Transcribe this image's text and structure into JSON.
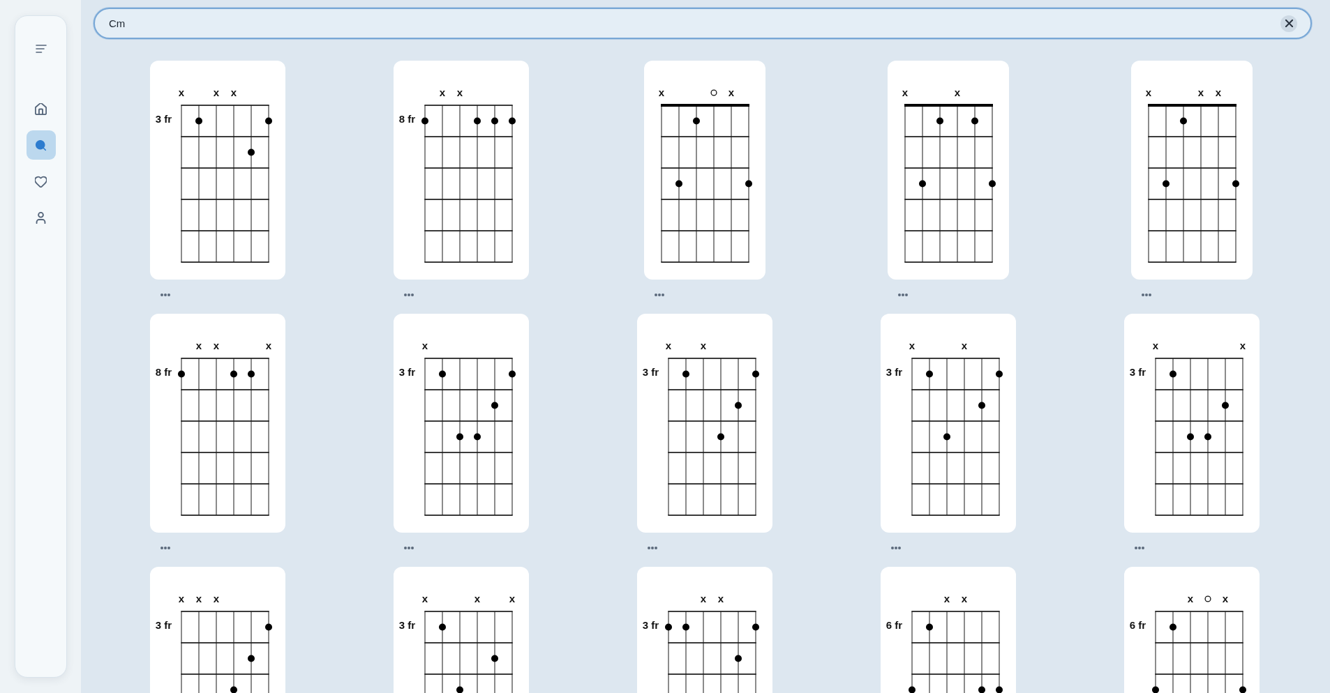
{
  "sidebar": {
    "nav": [
      {
        "kind": "home",
        "selected": false
      },
      {
        "kind": "search",
        "selected": true
      },
      {
        "kind": "favorites",
        "selected": false
      },
      {
        "kind": "profile",
        "selected": false
      }
    ]
  },
  "search": {
    "value": "Cm"
  },
  "chords": [
    {
      "fret_label": "3 fr",
      "nut": false,
      "strings": [
        {
          "marker": "x",
          "open": false
        },
        {
          "open": false
        },
        {
          "marker": "x",
          "open": false
        },
        {
          "marker": "x",
          "open": false
        },
        {
          "open": false
        },
        {
          "open": false
        }
      ],
      "frets": [
        [
          false,
          true,
          false,
          false,
          false,
          true
        ],
        [
          false,
          false,
          false,
          false,
          true,
          false
        ],
        [
          false,
          false,
          false,
          false,
          false,
          false
        ],
        [
          false,
          false,
          false,
          false,
          false,
          false
        ],
        [
          false,
          false,
          false,
          false,
          false,
          false
        ]
      ]
    },
    {
      "fret_label": "8 fr",
      "nut": false,
      "strings": [
        {
          "open": false
        },
        {
          "marker": "x",
          "open": false
        },
        {
          "marker": "x",
          "open": false
        },
        {
          "open": false
        },
        {
          "open": false
        },
        {
          "open": false
        }
      ],
      "frets": [
        [
          true,
          false,
          false,
          true,
          true,
          true
        ],
        [
          false,
          false,
          false,
          false,
          false,
          false
        ],
        [
          false,
          false,
          false,
          false,
          false,
          false
        ],
        [
          false,
          false,
          false,
          false,
          false,
          false
        ],
        [
          false,
          false,
          false,
          false,
          false,
          false
        ]
      ]
    },
    {
      "nut": true,
      "strings": [
        {
          "marker": "x",
          "open": false
        },
        {
          "open": false
        },
        {
          "open": false
        },
        {
          "open": true
        },
        {
          "marker": "x",
          "open": false
        },
        {
          "open": false
        }
      ],
      "frets": [
        [
          false,
          false,
          true,
          false,
          false,
          false
        ],
        [
          false,
          false,
          false,
          false,
          false,
          false
        ],
        [
          false,
          true,
          false,
          false,
          false,
          true
        ],
        [
          false,
          false,
          false,
          false,
          false,
          false
        ],
        [
          false,
          false,
          false,
          false,
          false,
          false
        ]
      ]
    },
    {
      "nut": true,
      "strings": [
        {
          "marker": "x",
          "open": false
        },
        {
          "open": false
        },
        {
          "open": false
        },
        {
          "marker": "x",
          "open": false
        },
        {
          "open": false
        },
        {
          "open": false
        }
      ],
      "frets": [
        [
          false,
          false,
          true,
          false,
          true,
          false
        ],
        [
          false,
          false,
          false,
          false,
          false,
          false
        ],
        [
          false,
          true,
          false,
          false,
          false,
          true
        ],
        [
          false,
          false,
          false,
          false,
          false,
          false
        ],
        [
          false,
          false,
          false,
          false,
          false,
          false
        ]
      ]
    },
    {
      "nut": true,
      "strings": [
        {
          "marker": "x",
          "open": false
        },
        {
          "open": false
        },
        {
          "open": false
        },
        {
          "marker": "x",
          "open": false
        },
        {
          "marker": "x",
          "open": false
        },
        {
          "open": false
        }
      ],
      "frets": [
        [
          false,
          false,
          true,
          false,
          false,
          false
        ],
        [
          false,
          false,
          false,
          false,
          false,
          false
        ],
        [
          false,
          true,
          false,
          false,
          false,
          true
        ],
        [
          false,
          false,
          false,
          false,
          false,
          false
        ],
        [
          false,
          false,
          false,
          false,
          false,
          false
        ]
      ]
    },
    {
      "fret_label": "8 fr",
      "nut": false,
      "strings": [
        {
          "open": false
        },
        {
          "marker": "x",
          "open": false
        },
        {
          "marker": "x",
          "open": false
        },
        {
          "open": false
        },
        {
          "open": false
        },
        {
          "marker": "x",
          "open": false
        }
      ],
      "frets": [
        [
          true,
          false,
          false,
          true,
          true,
          false
        ],
        [
          false,
          false,
          false,
          false,
          false,
          false
        ],
        [
          false,
          false,
          false,
          false,
          false,
          false
        ],
        [
          false,
          false,
          false,
          false,
          false,
          false
        ],
        [
          false,
          false,
          false,
          false,
          false,
          false
        ]
      ]
    },
    {
      "fret_label": "3 fr",
      "nut": false,
      "strings": [
        {
          "marker": "x",
          "open": false
        },
        {
          "open": false
        },
        {
          "open": false
        },
        {
          "open": false
        },
        {
          "open": false
        },
        {
          "open": false
        }
      ],
      "frets": [
        [
          false,
          true,
          false,
          false,
          false,
          true
        ],
        [
          false,
          false,
          false,
          false,
          true,
          false
        ],
        [
          false,
          false,
          true,
          true,
          false,
          false
        ],
        [
          false,
          false,
          false,
          false,
          false,
          false
        ],
        [
          false,
          false,
          false,
          false,
          false,
          false
        ]
      ]
    },
    {
      "fret_label": "3 fr",
      "nut": false,
      "strings": [
        {
          "marker": "x",
          "open": false
        },
        {
          "open": false
        },
        {
          "marker": "x",
          "open": false
        },
        {
          "open": false
        },
        {
          "open": false
        },
        {
          "open": false
        }
      ],
      "frets": [
        [
          false,
          true,
          false,
          false,
          false,
          true
        ],
        [
          false,
          false,
          false,
          false,
          true,
          false
        ],
        [
          false,
          false,
          false,
          true,
          false,
          false
        ],
        [
          false,
          false,
          false,
          false,
          false,
          false
        ],
        [
          false,
          false,
          false,
          false,
          false,
          false
        ]
      ]
    },
    {
      "fret_label": "3 fr",
      "nut": false,
      "strings": [
        {
          "marker": "x",
          "open": false
        },
        {
          "open": false
        },
        {
          "open": false
        },
        {
          "marker": "x",
          "open": false
        },
        {
          "open": false
        },
        {
          "open": false
        }
      ],
      "frets": [
        [
          false,
          true,
          false,
          false,
          false,
          true
        ],
        [
          false,
          false,
          false,
          false,
          true,
          false
        ],
        [
          false,
          false,
          true,
          false,
          false,
          false
        ],
        [
          false,
          false,
          false,
          false,
          false,
          false
        ],
        [
          false,
          false,
          false,
          false,
          false,
          false
        ]
      ]
    },
    {
      "fret_label": "3 fr",
      "nut": false,
      "strings": [
        {
          "marker": "x",
          "open": false
        },
        {
          "open": false
        },
        {
          "open": false
        },
        {
          "open": false
        },
        {
          "open": false
        },
        {
          "marker": "x",
          "open": false
        }
      ],
      "frets": [
        [
          false,
          true,
          false,
          false,
          false,
          false
        ],
        [
          false,
          false,
          false,
          false,
          true,
          false
        ],
        [
          false,
          false,
          true,
          true,
          false,
          false
        ],
        [
          false,
          false,
          false,
          false,
          false,
          false
        ],
        [
          false,
          false,
          false,
          false,
          false,
          false
        ]
      ]
    },
    {
      "fret_label": "3 fr",
      "nut": false,
      "strings": [
        {
          "marker": "x",
          "open": false
        },
        {
          "marker": "x",
          "open": false
        },
        {
          "marker": "x",
          "open": false
        },
        {
          "open": false
        },
        {
          "open": false
        },
        {
          "open": false
        }
      ],
      "frets": [
        [
          false,
          false,
          false,
          false,
          false,
          true
        ],
        [
          false,
          false,
          false,
          false,
          true,
          false
        ],
        [
          false,
          false,
          false,
          true,
          false,
          false
        ]
      ]
    },
    {
      "fret_label": "3 fr",
      "nut": false,
      "strings": [
        {
          "marker": "x",
          "open": false
        },
        {
          "open": false
        },
        {
          "open": false
        },
        {
          "marker": "x",
          "open": false
        },
        {
          "open": false
        },
        {
          "marker": "x",
          "open": false
        }
      ],
      "frets": [
        [
          false,
          true,
          false,
          false,
          false,
          false
        ],
        [
          false,
          false,
          false,
          false,
          true,
          false
        ],
        [
          false,
          false,
          true,
          false,
          false,
          false
        ]
      ]
    },
    {
      "fret_label": "3 fr",
      "nut": false,
      "strings": [
        {
          "open": false
        },
        {
          "open": false
        },
        {
          "marker": "x",
          "open": false
        },
        {
          "marker": "x",
          "open": false
        },
        {
          "open": false
        },
        {
          "open": false
        }
      ],
      "frets": [
        [
          true,
          true,
          false,
          false,
          false,
          true
        ],
        [
          false,
          false,
          false,
          false,
          true,
          false
        ],
        [
          false,
          false,
          false,
          false,
          false,
          false
        ]
      ]
    },
    {
      "fret_label": "6 fr",
      "nut": false,
      "strings": [
        {
          "open": false
        },
        {
          "open": false
        },
        {
          "marker": "x",
          "open": false
        },
        {
          "marker": "x",
          "open": false
        },
        {
          "open": false
        },
        {
          "open": false
        }
      ],
      "frets": [
        [
          false,
          true,
          false,
          false,
          false,
          false
        ],
        [
          false,
          false,
          false,
          false,
          false,
          false
        ],
        [
          true,
          false,
          false,
          false,
          true,
          true
        ]
      ]
    },
    {
      "fret_label": "6 fr",
      "nut": false,
      "strings": [
        {
          "open": false
        },
        {
          "open": false
        },
        {
          "marker": "x",
          "open": false
        },
        {
          "open": true
        },
        {
          "marker": "x",
          "open": false
        },
        {
          "open": false
        }
      ],
      "frets": [
        [
          false,
          true,
          false,
          false,
          false,
          false
        ],
        [
          false,
          false,
          false,
          false,
          false,
          false
        ],
        [
          true,
          false,
          false,
          false,
          false,
          true
        ]
      ]
    }
  ]
}
